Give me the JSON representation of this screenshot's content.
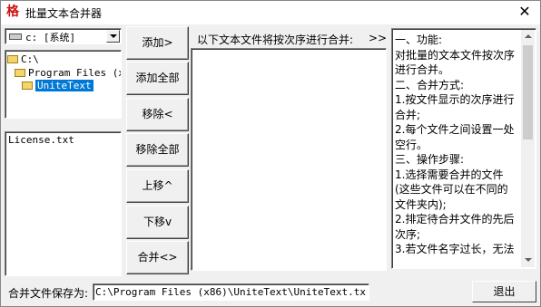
{
  "window": {
    "title": "批量文本合并器",
    "icon_char": "格",
    "close_glyph": "✕"
  },
  "drive": {
    "value": "c: [系统]"
  },
  "dir_tree": [
    {
      "label": "C:\\"
    },
    {
      "label": "Program Files (x86"
    },
    {
      "label": "UniteText",
      "selected": true
    }
  ],
  "files": [
    {
      "name": "License.txt"
    }
  ],
  "buttons": {
    "add": "添加>",
    "add_all": "添加全部>>",
    "remove": "移除<",
    "remove_all": "移除全部<<",
    "move_up": "上移^",
    "move_down": "下移v",
    "merge": "合并<>"
  },
  "merge_panel": {
    "label": "以下文本文件将按次序进行合并:",
    "arrows": ">>"
  },
  "help": [
    "一、功能:",
    "对批量的文本文件按次序进行合并。",
    "二、合并方式:",
    "1.按文件显示的次序进行合并;",
    "2.每个文件之间设置一处空行。",
    "三、操作步骤:",
    "1.选择需要合并的文件(这些文件可以在不同的文件夹内);",
    "2.排定待合并文件的先后次序;",
    "3.若文件名字过长，无法"
  ],
  "save": {
    "label": "合并文件保存为:",
    "path": "C:\\Program Files (x86)\\UniteText\\UniteText.txt"
  },
  "exit_button": "退出"
}
